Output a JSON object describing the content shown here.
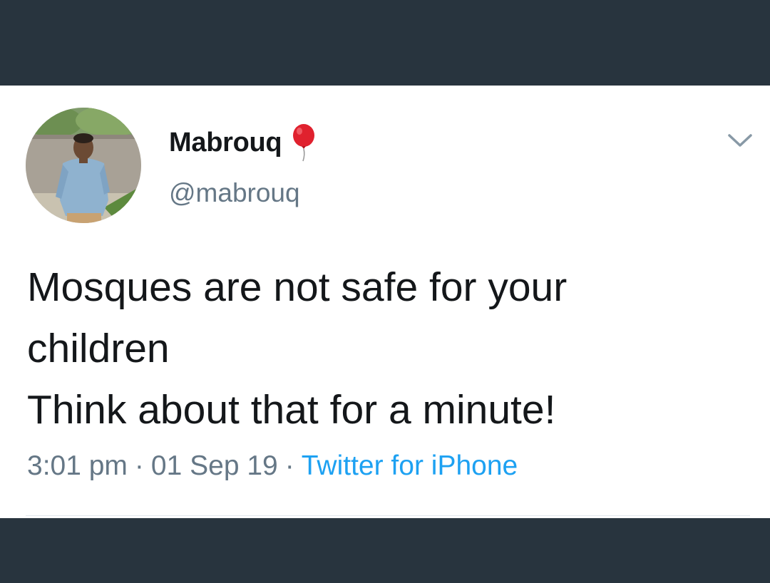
{
  "colors": {
    "frame_background": "#28343e",
    "card_background": "#ffffff",
    "name_color": "#14171a",
    "secondary_text": "#657786",
    "link_color": "#1da1f2",
    "balloon_red": "#e0212e"
  },
  "tweet": {
    "author": {
      "display_name": "Mabrouq",
      "name_emoji_icon": "red-balloon-icon",
      "handle": "@mabrouq",
      "avatar_icon": "profile-photo"
    },
    "text_lines": [
      "Mosques are not safe for your",
      "children",
      "Think about that for a minute!"
    ],
    "time": "3:01 pm",
    "date": "01 Sep 19",
    "source": "Twitter for iPhone",
    "separator": "·",
    "menu_icon": "chevron-down-icon"
  }
}
